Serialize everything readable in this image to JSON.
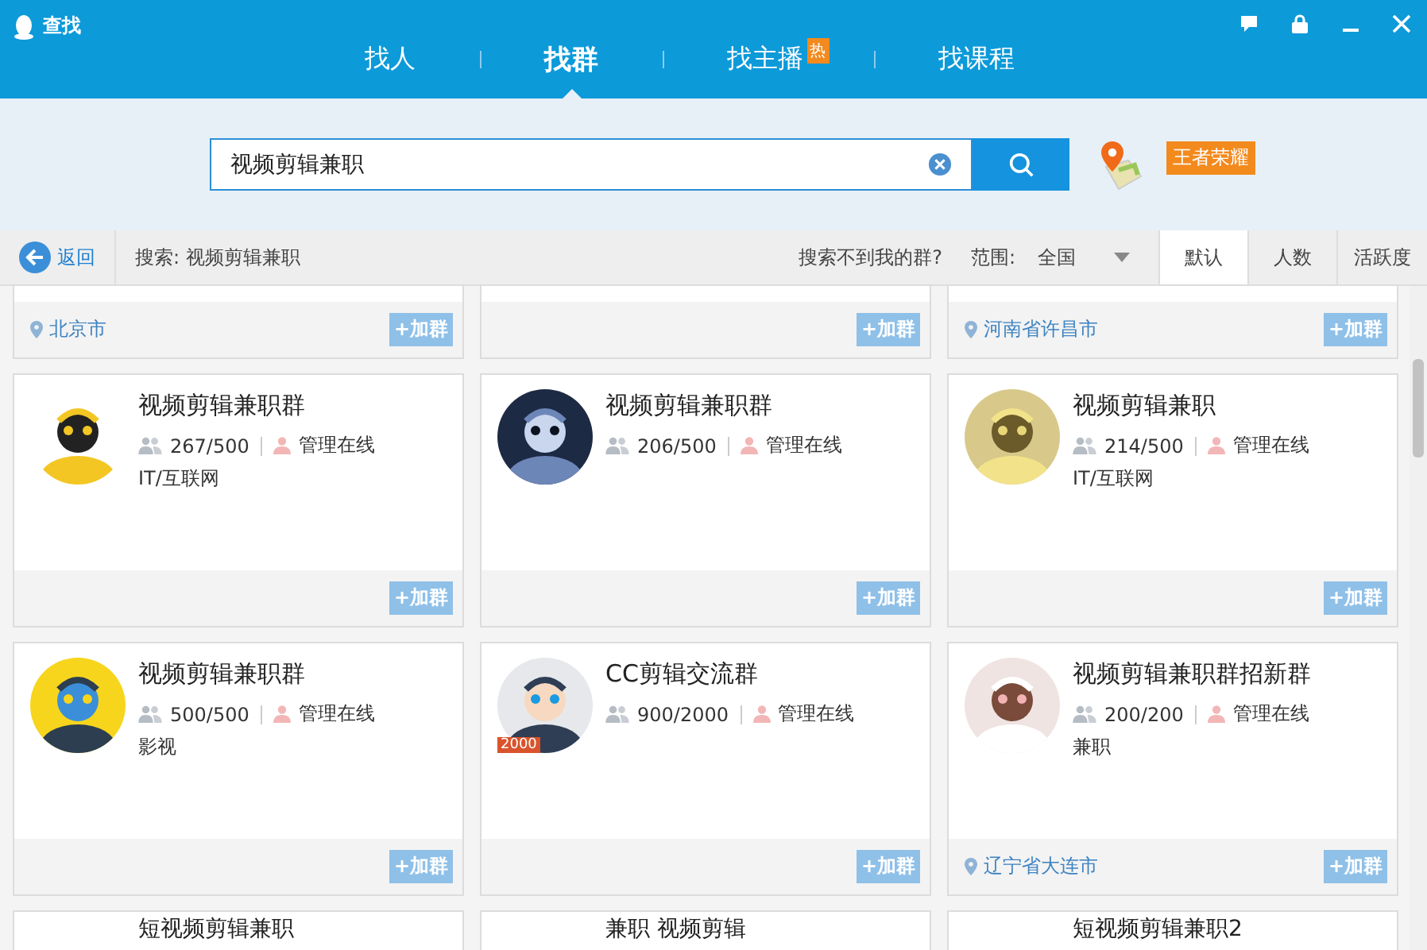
{
  "window": {
    "title": "查找"
  },
  "tabs": [
    {
      "label": "找人",
      "selected": false
    },
    {
      "label": "找群",
      "selected": true
    },
    {
      "label": "找主播",
      "selected": false,
      "badge": "热"
    },
    {
      "label": "找课程",
      "selected": false
    }
  ],
  "search": {
    "value": "视频剪辑兼职"
  },
  "promo": {
    "tag": "王者荣耀"
  },
  "toolbar": {
    "back": "返回",
    "query": "搜索: 视频剪辑兼职",
    "help_link": "搜索不到我的群?",
    "scope_label": "范围:",
    "scope_value": "全国",
    "sort_tabs": [
      {
        "label": "默认",
        "selected": true
      },
      {
        "label": "人数",
        "selected": false
      },
      {
        "label": "活跃度",
        "selected": false
      }
    ]
  },
  "groups": [
    {
      "kind": "footer",
      "location": "北京市",
      "join": "+加群"
    },
    {
      "kind": "footer",
      "join": "+加群"
    },
    {
      "kind": "footer",
      "location": "河南省许昌市",
      "join": "+加群"
    },
    {
      "kind": "full",
      "name": "视频剪辑兼职群",
      "members": "267/500",
      "admin": "管理在线",
      "category": "IT/互联网",
      "join": "+加群"
    },
    {
      "kind": "full",
      "name": "视频剪辑兼职群",
      "members": "206/500",
      "admin": "管理在线",
      "join": "+加群"
    },
    {
      "kind": "full",
      "name": "视频剪辑兼职",
      "members": "214/500",
      "admin": "管理在线",
      "category": "IT/互联网",
      "join": "+加群"
    },
    {
      "kind": "full",
      "name": "视频剪辑兼职群",
      "members": "500/500",
      "admin": "管理在线",
      "category": "影视",
      "join": "+加群"
    },
    {
      "kind": "full",
      "name": "CC剪辑交流群",
      "members": "900/2000",
      "admin": "管理在线",
      "badge": "2000",
      "join": "+加群"
    },
    {
      "kind": "full",
      "name": "视频剪辑兼职群招新群",
      "members": "200/200",
      "admin": "管理在线",
      "category": "兼职",
      "location": "辽宁省大连市",
      "join": "+加群"
    },
    {
      "kind": "header",
      "name": "短视频剪辑兼职"
    },
    {
      "kind": "header",
      "name": "兼职 视频剪辑"
    },
    {
      "kind": "header",
      "name": "短视频剪辑兼职2"
    }
  ]
}
